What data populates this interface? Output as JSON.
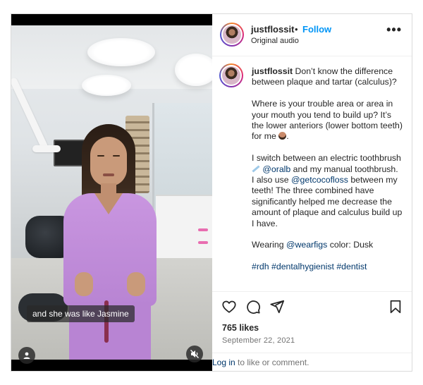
{
  "post": {
    "username": "justflossit",
    "separator": "•",
    "follow_label": "Follow",
    "audio_label": "Original audio",
    "more_label": "•••"
  },
  "video": {
    "caption_overlay": "and she was like Jasmine",
    "muted": true
  },
  "caption": {
    "username": "justflossit",
    "line1": "Don’t know the difference between plaque and tartar (calculus)?",
    "para2_before_emoji": "Where is your trouble area or area in your mouth you tend to build up? It’s the lower anteriors (lower bottom teeth) for me",
    "para3_a": "I switch between an electric toothbrush",
    "para3_mention1": "@oralb",
    "para3_b": "and my manual toothbrush. I also use",
    "para3_mention2": "@getcocofloss",
    "para3_c": "between my teeth! The three combined have significantly helped me decrease the amount of plaque and calculus build up I have.",
    "para4_a": "Wearing",
    "para4_mention": "@wearfigs",
    "para4_b": "color: Dusk",
    "hashtags": "#rdh #dentalhygienist #dentist"
  },
  "actions": {
    "icons": [
      "heart-icon",
      "comment-icon",
      "share-icon",
      "bookmark-icon"
    ]
  },
  "stats": {
    "likes": "765 likes",
    "date": "September 22, 2021"
  },
  "login": {
    "link": "Log in",
    "rest": "to like or comment."
  },
  "colors": {
    "follow_blue": "#0095f6",
    "link_navy": "#00376b",
    "scrub_purple": "#b884d3"
  }
}
